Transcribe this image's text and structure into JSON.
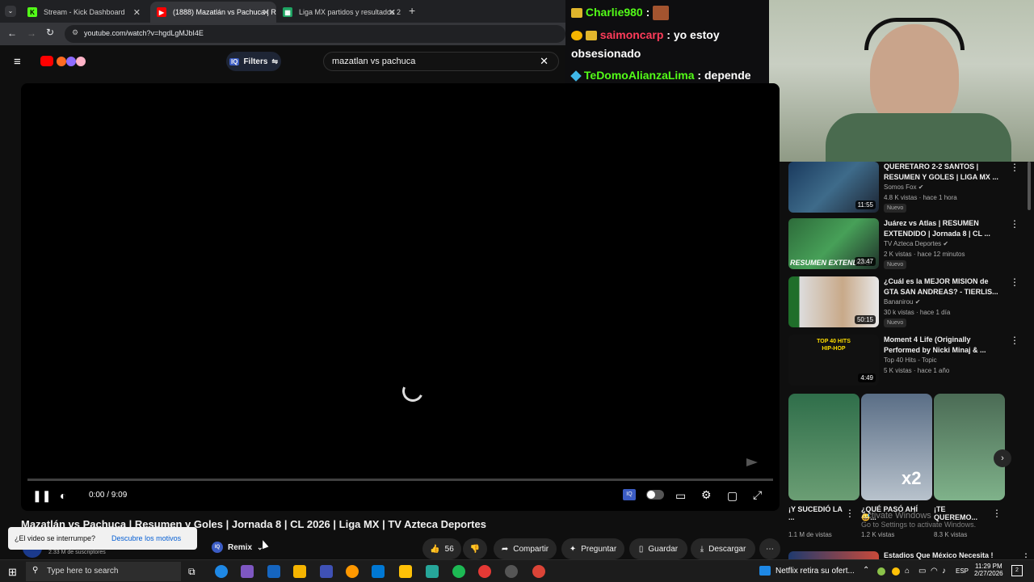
{
  "tabs": [
    {
      "label": "Stream - Kick Dashboard",
      "icon": "kick-icon"
    },
    {
      "label": "(1888) Mazatlán vs Pachuca | R",
      "icon": "youtube-icon"
    },
    {
      "label": "Liga MX partidos y resultados 2",
      "icon": "sheets-icon"
    }
  ],
  "address": {
    "url": "youtube.com/watch?v=hgdLgMJbI4E"
  },
  "header": {
    "filters_label": "Filters",
    "search_value": "mazatlan vs pachuca"
  },
  "chat": {
    "messages": [
      {
        "user": "Charlie980",
        "sep": " :",
        "text": ""
      },
      {
        "user": "saimoncarp",
        "sep": " :",
        "text": " yo estoy obsesionado"
      },
      {
        "user": "TeDomoAlianzaLima",
        "sep": " :",
        "text": " depende tambien ves nopor pokenil?"
      }
    ]
  },
  "player": {
    "time": "0:00 / 9:09",
    "progress": 0
  },
  "video": {
    "title": "Mazatlán vs Pachuca | Resumen y Goles | Jornada 8 | CL 2026 | Liga MX | TV Azteca Deportes",
    "subscribers": "2.33 M de suscriptores",
    "remix_label": "Remix",
    "likes": "56",
    "share_label": "Compartir",
    "ask_label": "Preguntar",
    "save_label": "Guardar",
    "download_label": "Descargar"
  },
  "tooltip": {
    "question": "¿El video se interrumpe?",
    "link": "Descubre los motivos"
  },
  "sidebar": {
    "videos": [
      {
        "title": "QUERETARO 2-2 SANTOS | RESUMEN Y GOLES | LIGA MX ...",
        "channel": "Somos Fox",
        "stats": "4.8 K vistas · hace 1 hora",
        "duration": "11:55",
        "badge": "Nuevo",
        "verified": true
      },
      {
        "title": "Juárez vs Atlas | RESUMEN EXTENDIDO | Jornada 8 | CL ...",
        "channel": "TV Azteca Deportes",
        "stats": "2 K vistas · hace 12 minutos",
        "duration": "23:47",
        "badge": "Nuevo",
        "verified": true
      },
      {
        "title": "¿Cuál es la MEJOR MISION de GTA SAN ANDREAS? - TIERLIS...",
        "channel": "Bananirou",
        "stats": "30 k vistas · hace 1 día",
        "duration": "50:15",
        "badge": "Nuevo",
        "verified": true
      },
      {
        "title": "Moment 4 Life (Originally Performed by Nicki Minaj & ...",
        "channel": "Top 40 Hits - Topic",
        "stats": "5 K vistas · hace 1 año",
        "duration": "4:49",
        "badge": "",
        "verified": false
      }
    ],
    "shorts": [
      {
        "title": "¡Y SUCEDIÓ LA ...",
        "views": "1.1 M de vistas"
      },
      {
        "title": "¿QUÉ PASÓ AHÍ 😅...",
        "views": "1.2 K vistas"
      },
      {
        "title": "¡TE QUEREMO...",
        "views": "8.3 K vistas"
      }
    ],
    "next_title": "Estadios Que México Necesita !"
  },
  "thumb_texts": {
    "resumen": "RESUMEN EXTENDIDO",
    "top40": "TOP 40 HITS HIP-HOP",
    "x2": "x2"
  },
  "windows": {
    "activate_title": "Activate Windows",
    "activate_sub": "Go to Settings to activate Windows."
  },
  "taskbar": {
    "search_placeholder": "Type here to search",
    "news": "Netflix retira su ofert...",
    "lang": "ESP",
    "time": "11:29 PM",
    "date": "2/27/2026",
    "notifications": "2"
  }
}
